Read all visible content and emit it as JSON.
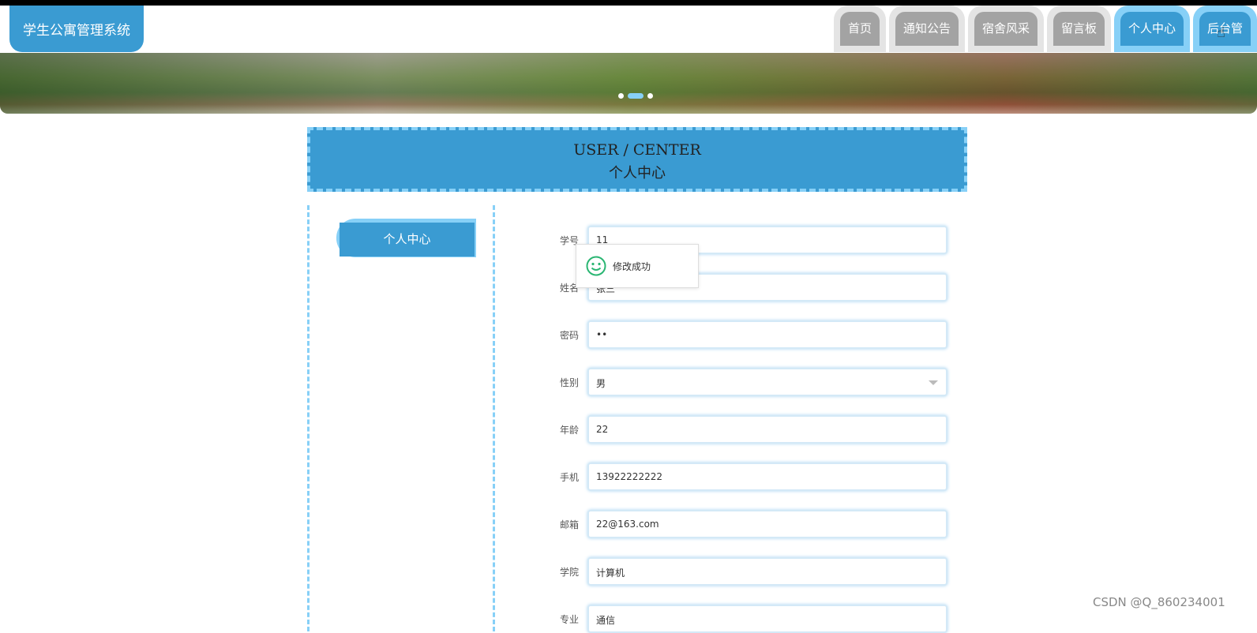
{
  "header": {
    "logo": "学生公寓管理系统",
    "nav": [
      {
        "label": "首页",
        "active": false
      },
      {
        "label": "通知公告",
        "active": false
      },
      {
        "label": "宿舍风采",
        "active": false
      },
      {
        "label": "留言板",
        "active": false
      },
      {
        "label": "个人中心",
        "active": true
      },
      {
        "label": "后台管",
        "active": true
      }
    ]
  },
  "banner": {
    "slides": 3,
    "active_slide": 2
  },
  "page": {
    "title_en": "USER / CENTER",
    "title_cn": "个人中心"
  },
  "sidebar": {
    "items": [
      {
        "label": "个人中心"
      }
    ]
  },
  "form": {
    "fields": [
      {
        "label": "学号",
        "value": "11"
      },
      {
        "label": "姓名",
        "value": "张三"
      },
      {
        "label": "密码",
        "value": "••"
      },
      {
        "label": "性别",
        "value": "男",
        "type": "select"
      },
      {
        "label": "年龄",
        "value": "22"
      },
      {
        "label": "手机",
        "value": "13922222222"
      },
      {
        "label": "邮箱",
        "value": "22@163.com"
      },
      {
        "label": "学院",
        "value": "计算机"
      },
      {
        "label": "专业",
        "value": "通信"
      }
    ]
  },
  "toast": {
    "message": "修改成功",
    "icon": "smile-icon",
    "color": "#2bb673"
  },
  "watermark": "CSDN @Q_860234001",
  "colors": {
    "primary": "#3a9bd2",
    "accent": "#87d0f7"
  }
}
